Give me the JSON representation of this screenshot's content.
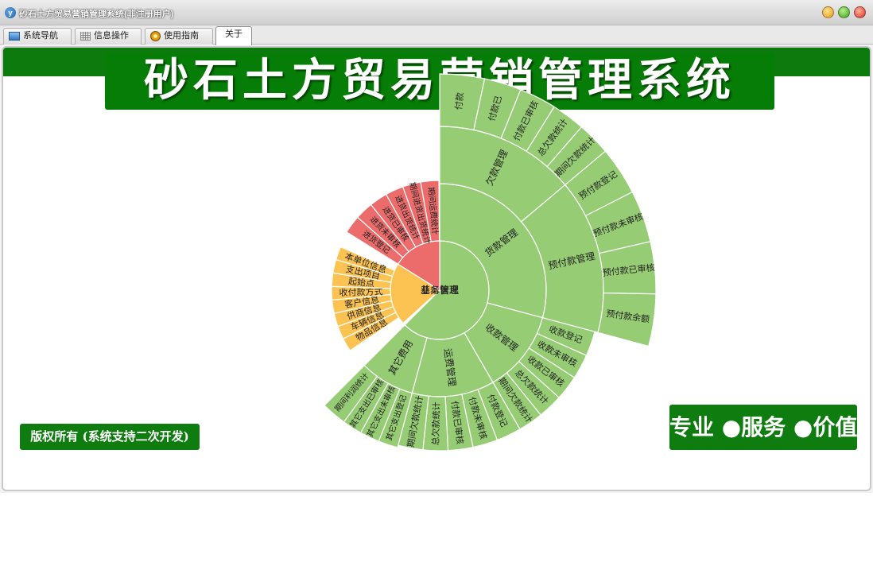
{
  "window": {
    "title": "砂石土方贸易营销管理系统(非注册用户)"
  },
  "tabs": [
    {
      "label": "系统导航",
      "icon": "monitor-icon"
    },
    {
      "label": "信息操作",
      "icon": "grid-icon"
    },
    {
      "label": "使用指南",
      "icon": "disc-icon"
    },
    {
      "label": "关于",
      "icon": ""
    }
  ],
  "banner": {
    "title": "砂石土方贸易营销管理系统"
  },
  "copyright": "版权所有 (系统支持二次开发)",
  "slogan": "专业 ●服务 ●价值",
  "colors": {
    "green": "#0e7c0e",
    "finance": "#96cd74",
    "basic": "#fcc352",
    "business": "#ec6c6c"
  },
  "sunburst": {
    "groups": [
      {
        "name": "财务管理",
        "color": "#96cd74",
        "children": [
          {
            "name": "货款管理",
            "children": [
              {
                "name": "欠款管理",
                "children": [
                  "付款",
                  "付款已",
                  "付款已审核",
                  "总欠款统计",
                  "期间欠款统计"
                ]
              },
              {
                "name": "预付款管理",
                "children": [
                  "预付款登记",
                  "预付款未审核",
                  "预付款已审核",
                  "预付款余额"
                ]
              }
            ]
          },
          {
            "name": "收款管理",
            "children": [
              "收款登记",
              "收款未审核",
              "收款已审核",
              "总欠款统计",
              "期间欠款统计"
            ]
          },
          {
            "name": "运费管理",
            "children": [
              "付款登记",
              "付款未审核",
              "付款已审核",
              "总欠款统计",
              "期间欠款统计"
            ]
          },
          {
            "name": "其它费用",
            "children": [
              "其它支出登记",
              "其它支出未审核",
              "其它支出已审核",
              "期间利润统计"
            ]
          }
        ]
      },
      {
        "name": "基本信息",
        "color": "#fcc352",
        "children": [
          "物品信息",
          "车辆信息",
          "供商信息",
          "客户信息",
          "收付款方式",
          "起始点",
          "支出项目",
          "本单位信息"
        ]
      },
      {
        "name": "业务管理",
        "color": "#ec6c6c",
        "children": [
          "进货登记",
          "进货未审核",
          "进货已审核",
          "进货出货统计",
          "期间进货出货统计",
          "期间运费统计"
        ]
      }
    ]
  }
}
